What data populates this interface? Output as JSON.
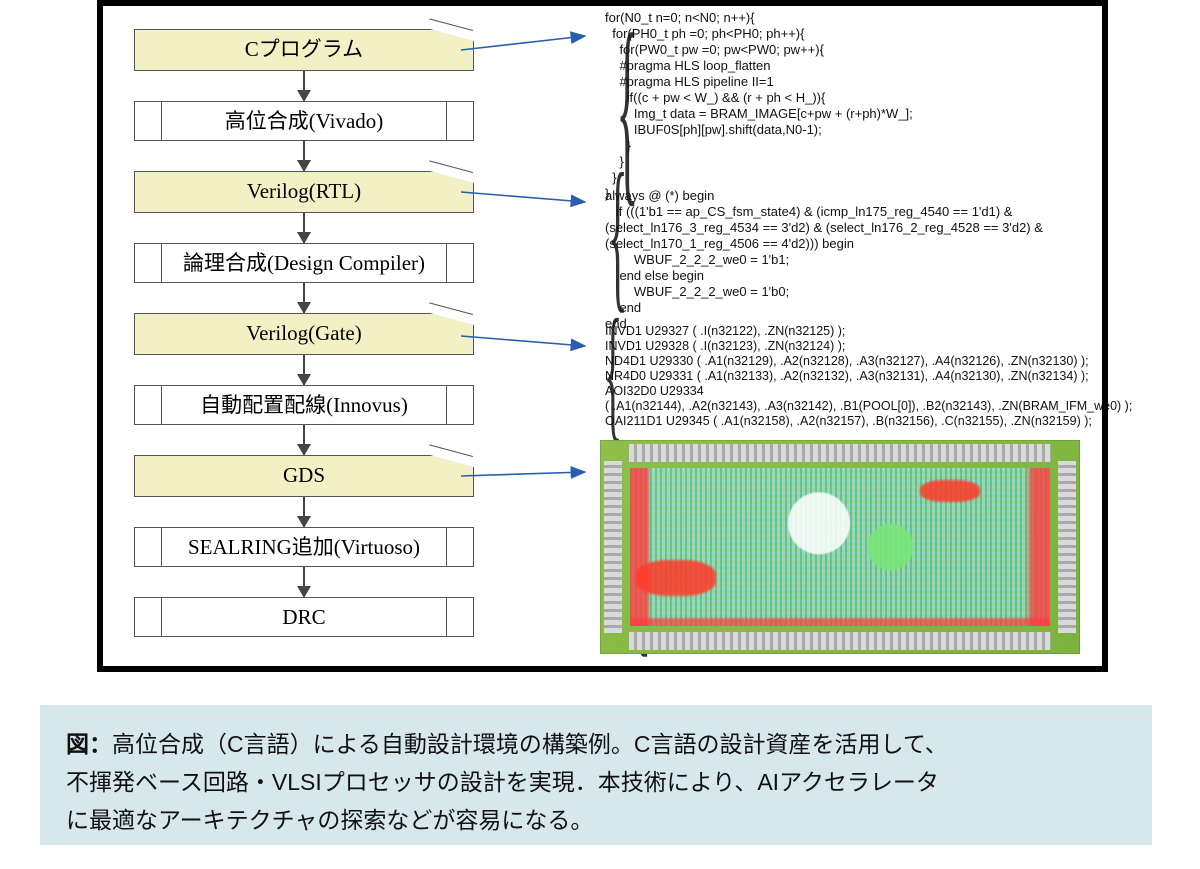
{
  "flow": {
    "steps": [
      {
        "kind": "doc",
        "label": "Cプログラム"
      },
      {
        "kind": "proc",
        "label": "高位合成(Vivado)"
      },
      {
        "kind": "doc",
        "label": "Verilog(RTL)"
      },
      {
        "kind": "proc",
        "label": "論理合成(Design Compiler)"
      },
      {
        "kind": "doc",
        "label": "Verilog(Gate)"
      },
      {
        "kind": "proc",
        "label": "自動配置配線(Innovus)"
      },
      {
        "kind": "doc",
        "label": "GDS"
      },
      {
        "kind": "proc",
        "label": "SEALRING追加(Virtuoso)"
      },
      {
        "kind": "proc",
        "label": "DRC"
      }
    ]
  },
  "code": {
    "c_program": "for(N0_t n=0; n<N0; n++){\n  for(PH0_t ph =0; ph<PH0; ph++){\n    for(PW0_t pw =0; pw<PW0; pw++){\n    #pragma HLS loop_flatten\n    #pragma HLS pipeline II=1\n      if((c + pw < W_) && (r + ph < H_)){\n        Img_t data = BRAM_IMAGE[c+pw + (r+ph)*W_];\n        IBUF0S[ph][pw].shift(data,N0-1);\n      }\n    }\n  }\n}",
    "rtl": "always @ (*) begin\n   if (((1'b1 == ap_CS_fsm_state4) & (icmp_ln175_reg_4540 == 1'd1) &\n(select_ln176_3_reg_4534 == 3'd2) & (select_ln176_2_reg_4528 == 3'd2) &\n(select_ln170_1_reg_4506 == 4'd2))) begin\n        WBUF_2_2_2_we0 = 1'b1;\n    end else begin\n        WBUF_2_2_2_we0 = 1'b0;\n    end\nend",
    "gate": "INVD1 U29327 ( .I(n32122), .ZN(n32125) );\nINVD1 U29328 ( .I(n32123), .ZN(n32124) );\nND4D1 U29330 ( .A1(n32129), .A2(n32128), .A3(n32127), .A4(n32126), .ZN(n32130) );\nNR4D0 U29331 ( .A1(n32133), .A2(n32132), .A3(n32131), .A4(n32130), .ZN(n32134) );\nAOI32D0 U29334\n( .A1(n32144), .A2(n32143), .A3(n32142), .B1(POOL[0]), .B2(n32143), .ZN(BRAM_IFM_we0) );\nOAI211D1 U29345 ( .A1(n32158), .A2(n32157), .B(n32156), .C(n32155), .ZN(n32159) );"
  },
  "caption": {
    "prefix": "図：",
    "line1_rest": "高位合成（C言語）による自動設計環境の構築例。C言語の設計資産を活用して、",
    "line2": "不揮発ベース回路・VLSIプロセッサの設計を実現．本技術により、AIアクセラレータ",
    "line3": "に最適なアーキテクチャの探索などが容易になる。"
  }
}
